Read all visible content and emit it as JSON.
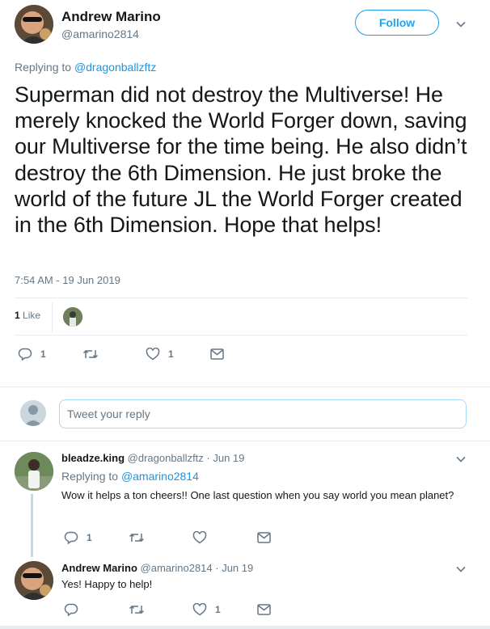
{
  "tweet": {
    "author_name": "Andrew Marino",
    "author_handle": "@amarino2814",
    "follow_label": "Follow",
    "replying_prefix": "Replying to",
    "replying_to": "@dragonballzftz",
    "text": "Superman did not destroy the Multiverse! He merely knocked the World Forger down, saving our Multiverse for the time being. He also didn’t destroy the 6th Dimension. He just broke the world of the future JL the World Forger created in the 6th Dimension. Hope that helps!",
    "timestamp": "7:54 AM - 19 Jun 2019",
    "likes_count": "1",
    "likes_label": "Like",
    "reply_count": "1",
    "like_count": "1"
  },
  "compose": {
    "placeholder": "Tweet your reply"
  },
  "replies": [
    {
      "author_name": "bleadze.king",
      "author_handle": "@dragonballzftz",
      "time": "· Jun 19",
      "replying_prefix": "Replying to",
      "replying_to": "@amarino2814",
      "text": "Wow it helps a ton cheers!! One last question when you say world you mean planet?",
      "reply_count": "1",
      "retweet_count": "",
      "like_count": ""
    },
    {
      "author_name": "Andrew Marino",
      "author_handle": "@amarino2814",
      "time": "· Jun 19",
      "text": "Yes! Happy to help!",
      "reply_count": "",
      "retweet_count": "",
      "like_count": "1"
    }
  ],
  "icons": {
    "reply": "reply-icon",
    "retweet": "retweet-icon",
    "like": "heart-icon",
    "message": "envelope-icon",
    "more": "chevron-down-icon"
  },
  "colors": {
    "accent": "#1da1f2",
    "link": "#1b95e0",
    "secondary_text": "#657786",
    "divider": "#e6ecf0"
  }
}
